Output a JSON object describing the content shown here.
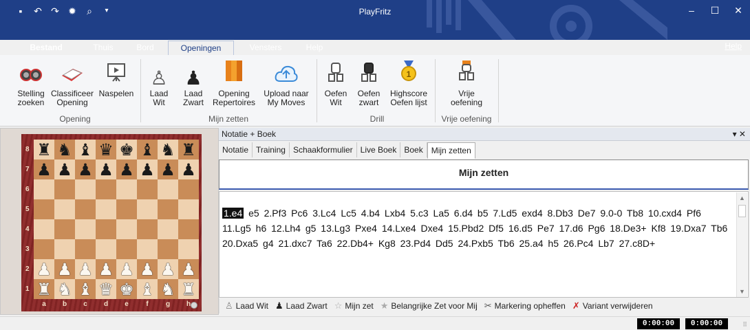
{
  "window": {
    "title": "PlayFritz"
  },
  "quick_access": [
    "save-icon",
    "undo-icon",
    "redo-icon",
    "engine-icon",
    "search-icon",
    "dropdown-icon"
  ],
  "menu": {
    "tabs": [
      "Bestand",
      "Thuis",
      "Bord",
      "Openingen",
      "Vensters",
      "Help"
    ],
    "active_tab": "Openingen",
    "help_right": "Help"
  },
  "ribbon": {
    "groups": [
      {
        "label": "Opening",
        "buttons": [
          {
            "label": "Stelling\nzoeken",
            "icon": "binoculars-icon"
          },
          {
            "label": "Classificeer\nOpening",
            "icon": "book-icon"
          },
          {
            "label": "Naspelen",
            "icon": "play-board-icon"
          }
        ]
      },
      {
        "label": "Mijn zetten",
        "buttons": [
          {
            "label": "Laad\nWit",
            "icon": "white-pawn-icon"
          },
          {
            "label": "Laad\nZwart",
            "icon": "black-pawn-icon"
          },
          {
            "label": "Opening\nRepertoires",
            "icon": "repertoire-books-icon"
          },
          {
            "label": "Upload naar\nMy Moves",
            "icon": "cloud-upload-icon"
          }
        ]
      },
      {
        "label": "Drill",
        "buttons": [
          {
            "label": "Oefen\nWit",
            "icon": "white-drill-icon"
          },
          {
            "label": "Oefen\nzwart",
            "icon": "black-drill-icon"
          },
          {
            "label": "Highscore\nOefen lijst",
            "icon": "medal-icon"
          }
        ]
      },
      {
        "label": "Vrije oefening",
        "buttons": [
          {
            "label": "Vrije\noefening",
            "icon": "free-training-icon"
          }
        ]
      }
    ]
  },
  "board": {
    "ranks": [
      "8",
      "7",
      "6",
      "5",
      "4",
      "3",
      "2",
      "1"
    ],
    "files": [
      "a",
      "b",
      "c",
      "d",
      "e",
      "f",
      "g",
      "h"
    ],
    "position": [
      "rnbqkbnr",
      "pppppppp",
      "........",
      "........",
      "........",
      "........",
      "PPPPPPPP",
      "RNBQKBNR"
    ]
  },
  "pane": {
    "title": "Notatie + Boek",
    "controls": "▾ ✕",
    "tabs": [
      "Notatie",
      "Training",
      "Schaakformulier",
      "Live Boek",
      "Boek",
      "Mijn zetten"
    ],
    "active_tab": "Mijn zetten",
    "heading": "Mijn zetten",
    "current_move": "1.e4",
    "moves": "e5 2.Pf3 Pc6 3.Lc4 Lc5 4.b4 Lxb4 5.c3 La5 6.d4 b5 7.Ld5 exd4 8.Db3 De7 9.0-0 Tb8 10.cxd4 Pf6 11.Lg5 h6 12.Lh4 g5 13.Lg3 Pxe4 14.Lxe4 Dxe4 15.Pbd2 Df5 16.d5 Pe7 17.d6 Pg6 18.De3+ Kf8 19.Dxa7 Tb6 20.Dxa5 g4 21.dxc7 Ta6 22.Db4+ Kg8 23.Pd4 Dd5 24.Pxb5 Tb6 25.a4 h5 26.Pc4 Lb7 27.c8D+"
  },
  "toolbar": {
    "items": [
      {
        "label": "Laad Wit",
        "icon": "white-pawn-icon"
      },
      {
        "label": "Laad Zwart",
        "icon": "black-pawn-icon"
      },
      {
        "label": "Mijn zet",
        "icon": "star-icon"
      },
      {
        "label": "Belangrijke Zet voor Mij",
        "icon": "star-plus-icon"
      },
      {
        "label": "Markering opheffen",
        "icon": "unmark-icon"
      },
      {
        "label": "Variant verwijderen",
        "icon": "delete-variant-icon"
      }
    ]
  },
  "status": {
    "clock_white": "0:00:00",
    "clock_black": "0:00:00"
  }
}
